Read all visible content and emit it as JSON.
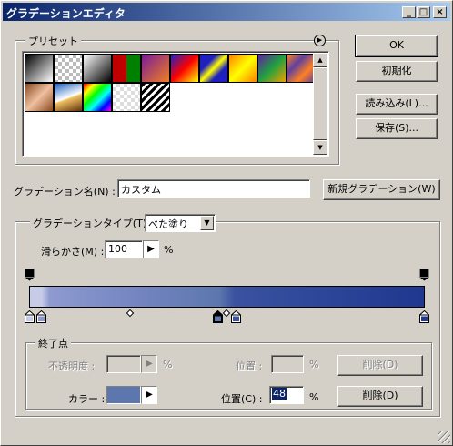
{
  "window": {
    "title": "グラデーションエディタ"
  },
  "presets": {
    "label": "プリセット",
    "count": 14
  },
  "buttons": {
    "ok": "OK",
    "reset": "初期化",
    "load": "読み込み(L)...",
    "save": "保存(S)...",
    "new_gradient": "新規グラデーション(W)",
    "delete_opacity": "削除(D)",
    "delete_color": "削除(D)"
  },
  "name": {
    "label": "グラデーション名(N) :",
    "value": "カスタム"
  },
  "type": {
    "label": "グラデーションタイプ(T) :",
    "value": "べた塗り"
  },
  "smoothness": {
    "label": "滑らかさ(M) :",
    "value": "100",
    "unit": "%"
  },
  "gradient": {
    "start_color": "#c6cbe8",
    "end_color": "#1f3890"
  },
  "stops": {
    "label": "終了点",
    "opacity_label": "不透明度 :",
    "opacity_unit": "%",
    "location_label_1": "位置 :",
    "location_unit_1": "%",
    "color_label": "カラー :",
    "color_swatch": "#5d77ae",
    "location_label_2": "位置(C) :",
    "location_value": "48",
    "location_unit_2": "%"
  }
}
